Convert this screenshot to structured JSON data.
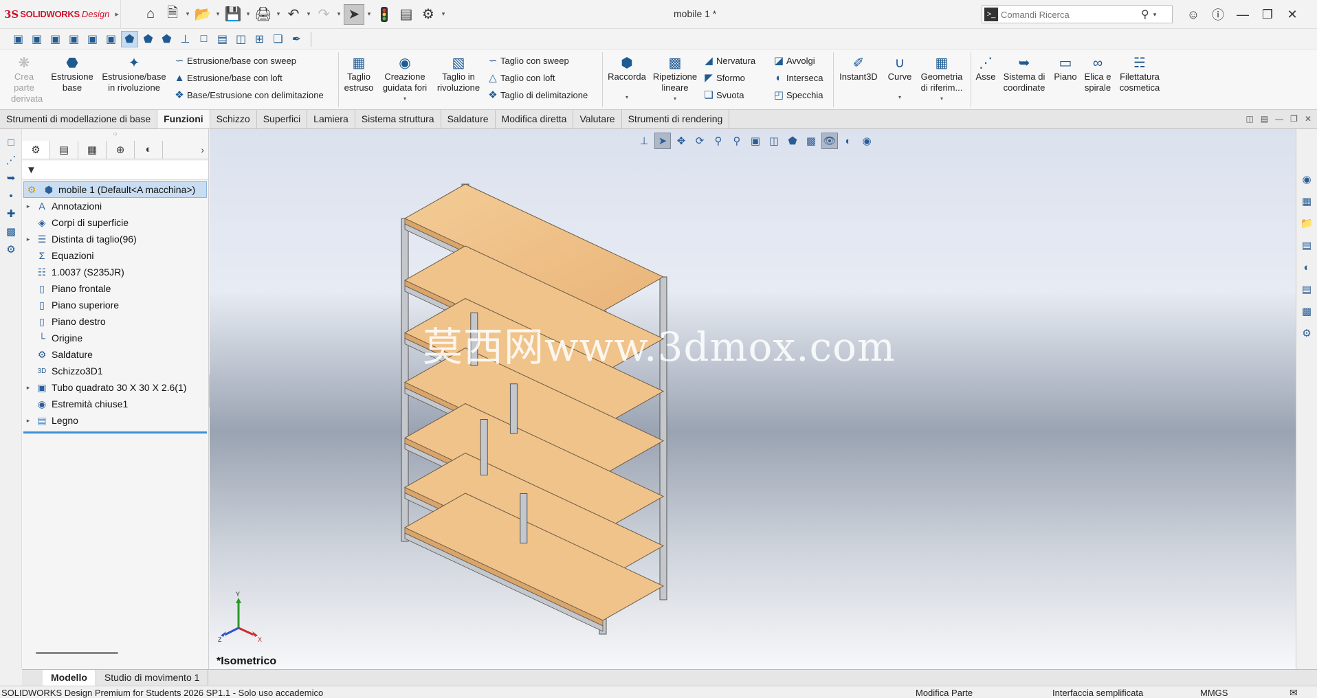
{
  "app": {
    "logo_ds": "3S",
    "logo_brand": "SOLIDWORKS",
    "logo_design": "Design",
    "document_title": "mobile 1 *",
    "brand_color": "#d0112b"
  },
  "search": {
    "placeholder": "Comandi Ricerca"
  },
  "ribbon": {
    "crea_parte": [
      "Crea",
      "parte",
      "derivata"
    ],
    "estrusione_base": [
      "Estrusione",
      "base"
    ],
    "estrusione_rivoluzione": [
      "Estrusione/base",
      "in rivoluzione"
    ],
    "sweep": "Estrusione/base con sweep",
    "loft": "Estrusione/base con loft",
    "delimitazione": "Base/Estrusione con delimitazione",
    "taglio_estruso": [
      "Taglio",
      "estruso"
    ],
    "creazione_fori": [
      "Creazione",
      "guidata fori"
    ],
    "taglio_rivoluzione": [
      "Taglio in",
      "rivoluzione"
    ],
    "taglio_sweep": "Taglio con sweep",
    "taglio_loft": "Taglio con loft",
    "taglio_delimitazione": "Taglio di delimitazione",
    "raccorda": "Raccorda",
    "ripetizione": [
      "Ripetizione",
      "lineare"
    ],
    "nervatura": "Nervatura",
    "sformo": "Sformo",
    "svuota": "Svuota",
    "avvolgi": "Avvolgi",
    "interseca": "Interseca",
    "specchia": "Specchia",
    "instant3d": "Instant3D",
    "curve": "Curve",
    "geometria": [
      "Geometria",
      "di riferim..."
    ],
    "asse": "Asse",
    "sistema": [
      "Sistema di",
      "coordinate"
    ],
    "piano": "Piano",
    "elica": [
      "Elica e",
      "spirale"
    ],
    "filettatura": [
      "Filettatura",
      "cosmetica"
    ]
  },
  "tabs": [
    "Strumenti di modellazione di base",
    "Funzioni",
    "Schizzo",
    "Superfici",
    "Lamiera",
    "Sistema struttura",
    "Saldature",
    "Modifica diretta",
    "Valutare",
    "Strumenti di rendering"
  ],
  "active_tab": "Funzioni",
  "tree": {
    "root": "mobile 1  (Default<A macchina>)",
    "items": [
      {
        "label": "Annotazioni",
        "icon": "annotation-icon",
        "expandable": true
      },
      {
        "label": "Corpi di superficie",
        "icon": "surface-bodies-icon",
        "expandable": false
      },
      {
        "label": "Distinta di taglio(96)",
        "icon": "cut-list-icon",
        "expandable": true
      },
      {
        "label": "Equazioni",
        "icon": "equations-icon",
        "expandable": false
      },
      {
        "label": "1.0037 (S235JR)",
        "icon": "material-icon",
        "expandable": false
      },
      {
        "label": "Piano frontale",
        "icon": "plane-icon",
        "expandable": false
      },
      {
        "label": "Piano superiore",
        "icon": "plane-icon",
        "expandable": false
      },
      {
        "label": "Piano destro",
        "icon": "plane-icon",
        "expandable": false
      },
      {
        "label": "Origine",
        "icon": "origin-icon",
        "expandable": false
      },
      {
        "label": "Saldature",
        "icon": "weldments-icon",
        "expandable": false
      },
      {
        "label": "Schizzo3D1",
        "icon": "sketch3d-icon",
        "expandable": false
      },
      {
        "label": "Tubo quadrato 30 X 30 X 2.6(1)",
        "icon": "structural-member-icon",
        "expandable": true
      },
      {
        "label": "Estremità chiuse1",
        "icon": "end-cap-icon",
        "expandable": false
      },
      {
        "label": "Legno",
        "icon": "folder-icon",
        "expandable": true
      }
    ]
  },
  "viewport": {
    "watermark": "莫西网www.3dmox.com",
    "view_name": "*Isometrico",
    "triad_axes": [
      "Y",
      "Z",
      "X"
    ],
    "wood_color": "#f0c38a",
    "frame_color": "#c4c7cc"
  },
  "bottom_tabs": [
    "Modello",
    "Studio di movimento 1"
  ],
  "status": {
    "left": "SOLIDWORKS Design Premium for Students 2026 SP1.1 - Solo uso accademico",
    "mode": "Modifica Parte",
    "interface": "Interfaccia semplificata",
    "units": "MMGS"
  }
}
